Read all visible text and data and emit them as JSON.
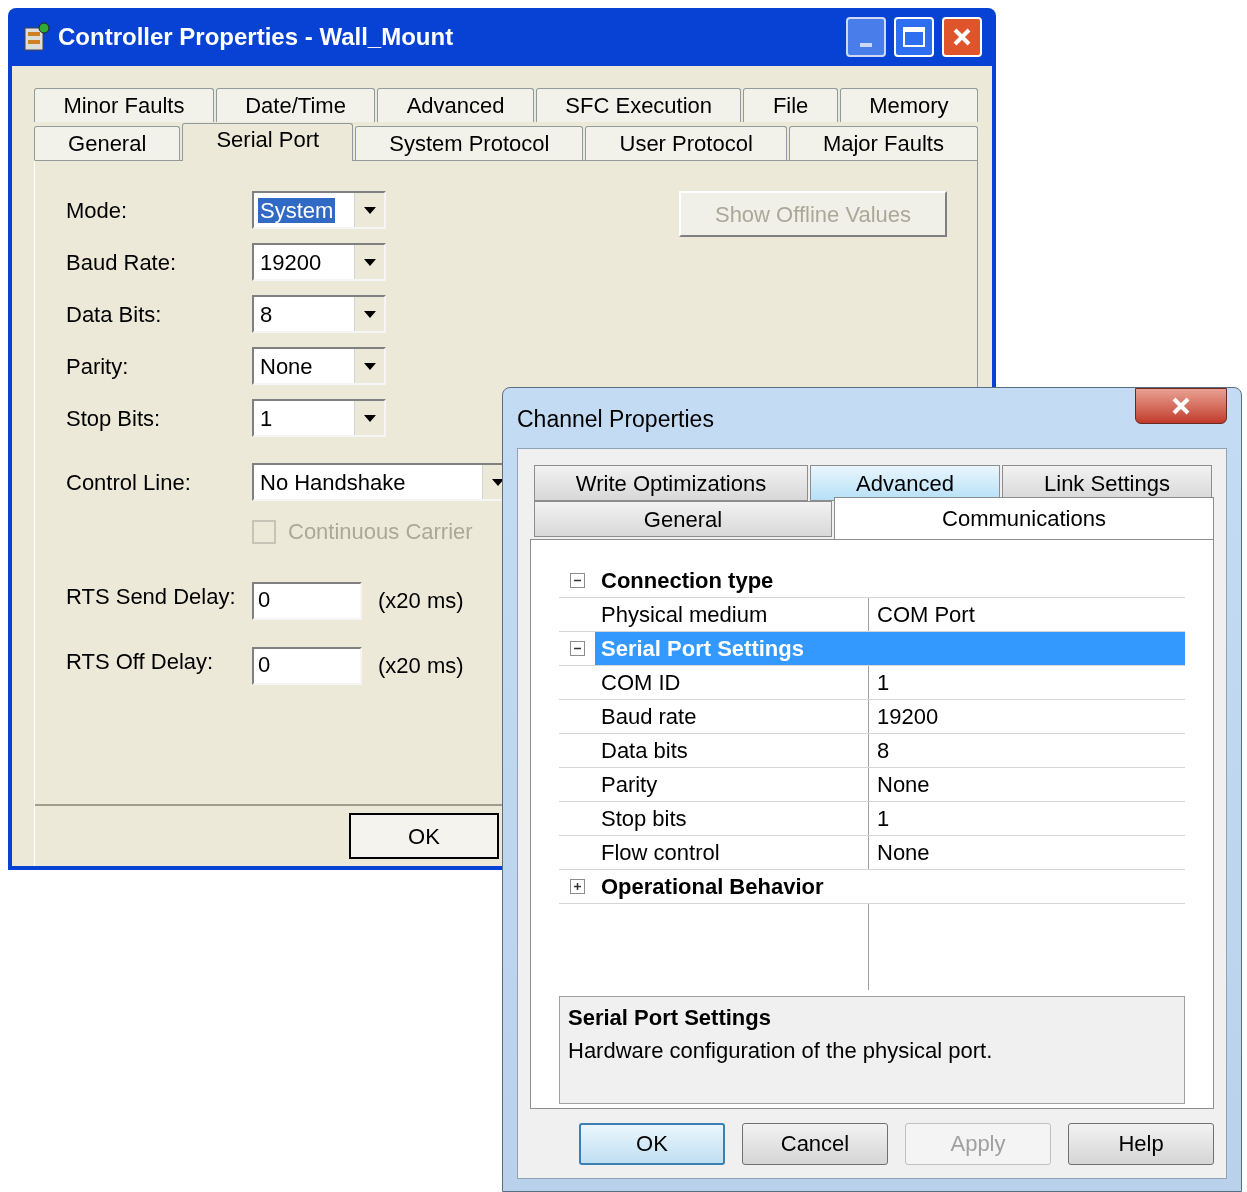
{
  "controller_window": {
    "title": "Controller Properties - Wall_Mount",
    "tab_rows": [
      [
        {
          "label": "Minor Faults",
          "selected": false
        },
        {
          "label": "Date/Time",
          "selected": false
        },
        {
          "label": "Advanced",
          "selected": false
        },
        {
          "label": "SFC Execution",
          "selected": false
        },
        {
          "label": "File",
          "selected": false
        },
        {
          "label": "Memory",
          "selected": false
        }
      ],
      [
        {
          "label": "General",
          "selected": false
        },
        {
          "label": "Serial Port",
          "selected": true
        },
        {
          "label": "System Protocol",
          "selected": false
        },
        {
          "label": "User Protocol",
          "selected": false
        },
        {
          "label": "Major Faults",
          "selected": false
        }
      ]
    ],
    "show_offline_button": {
      "label": "Show Offline Values",
      "disabled": true
    },
    "fields": [
      {
        "kind": "dropdown",
        "label": "Mode:",
        "value": "System",
        "highlighted": true
      },
      {
        "kind": "dropdown",
        "label": "Baud Rate:",
        "value": "19200",
        "highlighted": false
      },
      {
        "kind": "dropdown",
        "label": "Data Bits:",
        "value": "8",
        "highlighted": false
      },
      {
        "kind": "dropdown",
        "label": "Parity:",
        "value": "None",
        "highlighted": false
      },
      {
        "kind": "dropdown",
        "label": "Stop Bits:",
        "value": "1",
        "highlighted": false
      },
      {
        "kind": "wide_dropdown",
        "label": "Control Line:",
        "value": "No Handshake",
        "highlighted": false
      },
      {
        "kind": "checkbox",
        "label": "Continuous Carrier",
        "checked": false,
        "disabled": true
      },
      {
        "kind": "text",
        "label": "RTS Send Delay:",
        "value": "0",
        "unit": "(x20 ms)"
      },
      {
        "kind": "text",
        "label": "RTS Off Delay:",
        "value": "0",
        "unit": "(x20 ms)"
      }
    ],
    "ok_button": "OK"
  },
  "channel_window": {
    "title": "Channel Properties",
    "tab_rows": [
      [
        {
          "label": "Write Optimizations",
          "selected": false,
          "hovered": false
        },
        {
          "label": "Advanced",
          "selected": false,
          "hovered": true
        },
        {
          "label": "Link Settings",
          "selected": false,
          "hovered": false
        }
      ],
      [
        {
          "label": "General",
          "selected": false,
          "hovered": false
        },
        {
          "label": "Communications",
          "selected": true,
          "hovered": false
        }
      ]
    ],
    "categories": [
      {
        "name": "Connection type",
        "expanded": true,
        "selected": false,
        "rows": [
          {
            "name": "Physical medium",
            "value": "COM Port"
          }
        ]
      },
      {
        "name": "Serial Port Settings",
        "expanded": true,
        "selected": true,
        "rows": [
          {
            "name": "COM ID",
            "value": "1"
          },
          {
            "name": "Baud rate",
            "value": "19200"
          },
          {
            "name": "Data bits",
            "value": "8"
          },
          {
            "name": "Parity",
            "value": "None"
          },
          {
            "name": "Stop bits",
            "value": "1"
          },
          {
            "name": "Flow control",
            "value": "None"
          }
        ]
      },
      {
        "name": "Operational Behavior",
        "expanded": false,
        "selected": false
      }
    ],
    "description": {
      "title": "Serial Port Settings",
      "text": "Hardware configuration of the physical port."
    },
    "buttons": [
      {
        "label": "OK",
        "default": true,
        "disabled": false
      },
      {
        "label": "Cancel",
        "default": false,
        "disabled": false
      },
      {
        "label": "Apply",
        "default": false,
        "disabled": true
      },
      {
        "label": "Help",
        "default": false,
        "disabled": false
      }
    ]
  }
}
